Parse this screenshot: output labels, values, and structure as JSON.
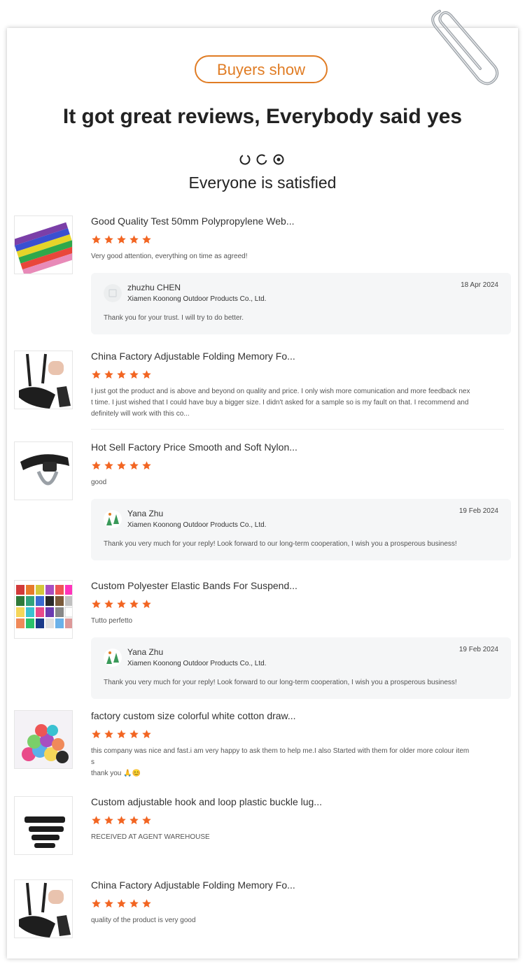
{
  "header": {
    "badge": "Buyers show",
    "headline": "It got great reviews, Everybody said yes",
    "subhead": "Everyone is satisfied"
  },
  "colors": {
    "accent": "#e07c24",
    "star": "#f26522"
  },
  "reviews": [
    {
      "title": "Good Quality Test 50mm Polypropylene Web...",
      "stars": 5,
      "text": "Very good attention, everything on time as agreed!",
      "reply": {
        "name": "zhuzhu CHEN",
        "company": "Xiamen Koonong Outdoor Products Co., Ltd.",
        "date": "18 Apr 2024",
        "message": "Thank you for your trust. I will try to do better."
      }
    },
    {
      "title": "China Factory Adjustable Folding Memory Fo...",
      "stars": 5,
      "text_lines": [
        "I just got the product and is above and beyond on quality and price. I only wish more comunication and more feedback nex",
        "t time. I just wished that I could have buy a bigger size. I didn't asked for a sample so is my fault on that. I recommend and",
        "definitely will work with this co..."
      ]
    },
    {
      "title": "Hot Sell Factory Price Smooth and Soft Nylon...",
      "stars": 5,
      "text": "good",
      "reply": {
        "name": "Yana Zhu",
        "company": "Xiamen Koonong Outdoor Products Co., Ltd.",
        "date": "19 Feb 2024",
        "message": "Thank you very much for your reply! Look forward to our long-term cooperation, I wish you a prosperous business!"
      }
    },
    {
      "title": "Custom Polyester Elastic Bands For Suspend...",
      "stars": 5,
      "text": "Tutto perfetto",
      "reply": {
        "name": "Yana Zhu",
        "company": "Xiamen Koonong Outdoor Products Co., Ltd.",
        "date": "19 Feb 2024",
        "message": "Thank you very much for your reply! Look forward to our long-term cooperation, I wish you a prosperous business!"
      }
    },
    {
      "title": "factory custom size colorful white cotton draw...",
      "stars": 5,
      "text_lines": [
        "this company was nice and fast.i am very happy to ask them to help me.I also Started with them for older more colour item",
        "s",
        "thank you 🙏😊"
      ]
    },
    {
      "title": "Custom adjustable hook and loop plastic buckle lug...",
      "stars": 5,
      "text": "RECEIVED AT AGENT WAREHOUSE"
    },
    {
      "title": "China Factory Adjustable Folding Memory Fo...",
      "stars": 5,
      "text": "quality of the product is very good"
    }
  ]
}
